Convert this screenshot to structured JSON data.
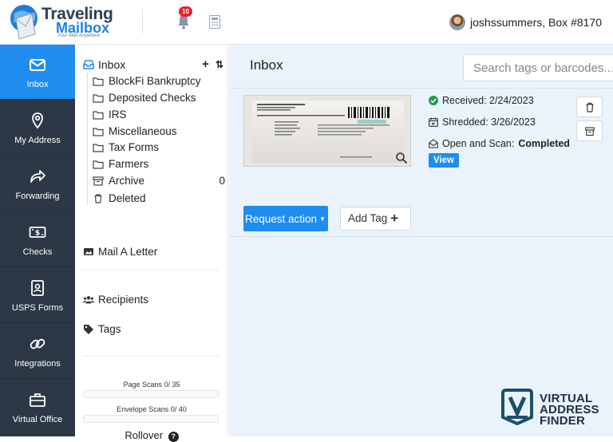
{
  "brand": {
    "name_line1": "Traveling",
    "name_line2": "Mailbox",
    "tagline": "Your Mail Anywhere"
  },
  "header": {
    "notification_count": "10",
    "user_label": "joshssummers, Box #8170"
  },
  "nav": {
    "items": [
      {
        "label": "Inbox",
        "icon": "inbox-icon",
        "active": true
      },
      {
        "label": "My Address",
        "icon": "location-pin-icon"
      },
      {
        "label": "Forwarding",
        "icon": "forward-arrow-icon"
      },
      {
        "label": "Checks",
        "icon": "check-bill-icon"
      },
      {
        "label": "USPS Forms",
        "icon": "contact-form-icon"
      },
      {
        "label": "Integrations",
        "icon": "link-icon"
      },
      {
        "label": "Virtual Office",
        "icon": "briefcase-icon"
      }
    ]
  },
  "folders": {
    "root_label": "Inbox",
    "items": [
      {
        "label": "BlockFi Bankruptcy",
        "icon": "folder-icon"
      },
      {
        "label": "Deposited Checks",
        "icon": "folder-icon"
      },
      {
        "label": "IRS",
        "icon": "folder-icon"
      },
      {
        "label": "Miscellaneous",
        "icon": "folder-icon"
      },
      {
        "label": "Tax Forms",
        "icon": "folder-icon"
      },
      {
        "label": "Farmers",
        "icon": "folder-icon"
      },
      {
        "label": "Archive",
        "icon": "archive-icon",
        "count": "0"
      },
      {
        "label": "Deleted",
        "icon": "trash-icon"
      }
    ],
    "links": {
      "mail_letter": "Mail A Letter",
      "recipients": "Recipients",
      "tags": "Tags"
    },
    "page_scans": "Page Scans 0/ 35",
    "envelope_scans": "Envelope Scans 0/ 40",
    "rollover": "Rollover"
  },
  "main": {
    "title": "Inbox",
    "search_placeholder": "Search tags or barcodes...",
    "mail_item": {
      "received": "Received: 2/24/2023",
      "shredded": "Shredded: 3/26/2023",
      "scan_label": "Open and Scan:",
      "scan_status": "Completed",
      "view_label": "View"
    },
    "request_action_label": "Request action",
    "add_tag_label": "Add Tag"
  },
  "watermark": {
    "line1": "VIRTUAL",
    "line2": "ADDRESS",
    "line3": "FINDER"
  },
  "colors": {
    "accent": "#1f8cf0",
    "nav_bg": "#2c3845",
    "main_bg": "#eaf3fc",
    "badge": "#e4222a",
    "status_ok": "#1e9e4a"
  }
}
